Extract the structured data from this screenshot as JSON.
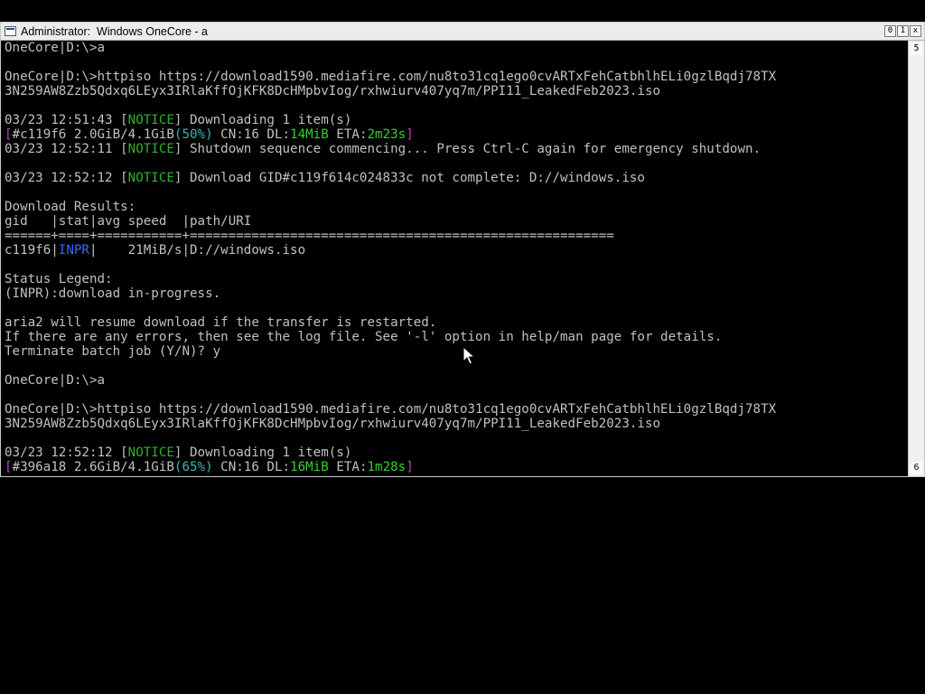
{
  "window": {
    "title": "Administrator:  Windows OneCore - a",
    "controls": {
      "minimize": "0",
      "maximize": "1",
      "close": "x"
    },
    "scrollbar": {
      "up_label": "5",
      "down_label": "6"
    }
  },
  "colors": {
    "default": "#c0c0c0",
    "notice": "#2fb12f",
    "bracket": "#c43cc4",
    "speed": "#30d030",
    "eta": "#30d030",
    "percent": "#38b8b8",
    "status": "#3c64ff"
  },
  "console": {
    "lines": [
      [
        {
          "t": "OneCore|D:\\>a"
        }
      ],
      [],
      [
        {
          "t": "OneCore|D:\\>httpiso https://download1590.mediafire.com/nu8to31cq1ego0cvARTxFehCatbhlhELi0gzlBqdj78TX"
        }
      ],
      [
        {
          "t": "3N259AW8Zzb5Qdxq6LEyx3IRlaKffOjKFK8DcHMpbvIog/rxhwiurv407yq7m/PPI11_LeakedFeb2023.iso"
        }
      ],
      [],
      [
        {
          "t": "03/23 12:51:43 ["
        },
        {
          "t": "NOTICE",
          "c": "notice"
        },
        {
          "t": "] Downloading 1 item(s)"
        }
      ],
      [
        {
          "t": "[",
          "c": "bracket"
        },
        {
          "t": "#c119f6 2.0GiB/4.1GiB"
        },
        {
          "t": "(50%)",
          "c": "percent"
        },
        {
          "t": " CN:16 DL:"
        },
        {
          "t": "14MiB",
          "c": "speed"
        },
        {
          "t": " ETA:"
        },
        {
          "t": "2m23s",
          "c": "eta"
        },
        {
          "t": "]",
          "c": "bracket"
        }
      ],
      [
        {
          "t": "03/23 12:52:11 ["
        },
        {
          "t": "NOTICE",
          "c": "notice"
        },
        {
          "t": "] Shutdown sequence commencing... Press Ctrl-C again for emergency shutdown."
        }
      ],
      [],
      [
        {
          "t": "03/23 12:52:12 ["
        },
        {
          "t": "NOTICE",
          "c": "notice"
        },
        {
          "t": "] Download GID#c119f614c024833c not complete: D://windows.iso"
        }
      ],
      [],
      [
        {
          "t": "Download Results:"
        }
      ],
      [
        {
          "t": "gid   |stat|avg speed  |path/URI"
        }
      ],
      [
        {
          "t": "======+====+===========+======================================================="
        }
      ],
      [
        {
          "t": "c119f6|"
        },
        {
          "t": "INPR",
          "c": "status"
        },
        {
          "t": "|    21MiB/s|D://windows.iso"
        }
      ],
      [],
      [
        {
          "t": "Status Legend:"
        }
      ],
      [
        {
          "t": "(INPR):download in-progress."
        }
      ],
      [],
      [
        {
          "t": "aria2 will resume download if the transfer is restarted."
        }
      ],
      [
        {
          "t": "If there are any errors, then see the log file. See '-l' option in help/man page for details."
        }
      ],
      [
        {
          "t": "Terminate batch job (Y/N)? y"
        }
      ],
      [],
      [
        {
          "t": "OneCore|D:\\>a"
        }
      ],
      [],
      [
        {
          "t": "OneCore|D:\\>httpiso https://download1590.mediafire.com/nu8to31cq1ego0cvARTxFehCatbhlhELi0gzlBqdj78TX"
        }
      ],
      [
        {
          "t": "3N259AW8Zzb5Qdxq6LEyx3IRlaKffOjKFK8DcHMpbvIog/rxhwiurv407yq7m/PPI11_LeakedFeb2023.iso"
        }
      ],
      [],
      [
        {
          "t": "03/23 12:52:12 ["
        },
        {
          "t": "NOTICE",
          "c": "notice"
        },
        {
          "t": "] Downloading 1 item(s)"
        }
      ],
      [
        {
          "t": "[",
          "c": "bracket"
        },
        {
          "t": "#396a18 2.6GiB/4.1GiB"
        },
        {
          "t": "(65%)",
          "c": "percent"
        },
        {
          "t": " CN:16 DL:"
        },
        {
          "t": "16MiB",
          "c": "speed"
        },
        {
          "t": " ETA:"
        },
        {
          "t": "1m28s",
          "c": "eta"
        },
        {
          "t": "]",
          "c": "bracket"
        }
      ]
    ]
  }
}
